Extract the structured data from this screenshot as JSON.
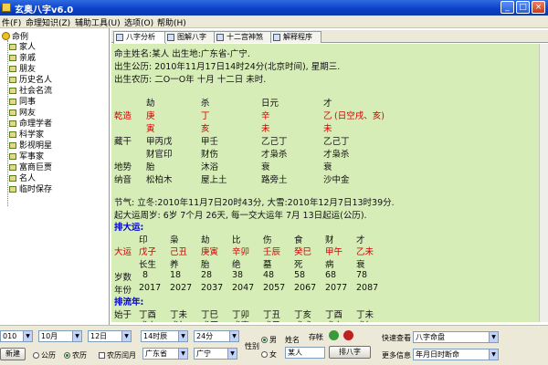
{
  "window": {
    "title": "玄奥八字v6.0",
    "minimize": "_",
    "maximize": "□",
    "close": "×"
  },
  "menu": [
    "件(F)",
    "命理知识(Z)",
    "辅助工具(U)",
    "选项(O)",
    "帮助(H)"
  ],
  "tree": {
    "root": "命例",
    "items": [
      "家人",
      "亲戚",
      "朋友",
      "历史名人",
      "社会名流",
      "同事",
      "网友",
      "命理学者",
      "科学家",
      "影视明星",
      "军事家",
      "富商巨贾",
      "名人",
      "临时保存"
    ]
  },
  "tabs": [
    "八字分析",
    "图解八字",
    "十二宫神煞",
    "解释程序"
  ],
  "chart": {
    "name_line": "命主姓名:某人  出生地:广东省-广宁.",
    "solar_line": "出生公历: 2010年11月17日14时24分(北京时间), 星期三.",
    "lunar_line": "出生农历: 二O一O年 十月 十二日 未时.",
    "gods_row": [
      "劫",
      "杀",
      "日元",
      "才"
    ],
    "qianzao_label": "乾造",
    "stems": [
      "庚",
      "丁",
      "辛",
      "乙"
    ],
    "kongwang": "(日空戌、亥)",
    "branches": [
      "寅",
      "亥",
      "未",
      "未"
    ],
    "canggan_label": "藏干",
    "canggan": [
      "甲丙戊",
      "甲壬",
      "乙己丁",
      "乙己丁"
    ],
    "canggan_gods": [
      "财官印",
      "财伤",
      "才枭杀",
      "才枭杀"
    ],
    "dishi_label": "地势",
    "dishi": [
      "胎",
      "沐浴",
      "衰",
      "衰"
    ],
    "nayin_label": "纳音",
    "nayin": [
      "松柏木",
      "屋上土",
      "路旁土",
      "沙中金"
    ],
    "jieqi_line": "节气: 立冬:2010年11月7日20时43分, 大雪:2010年12月7日13时39分.",
    "qiyun_line": "起大运周岁: 6岁 7个月 26天, 每一交大运年 7月 13日起运(公历).",
    "dayun_title": "排大运:",
    "dayun_gods": [
      "印",
      "枭",
      "劫",
      "比",
      "伤",
      "食",
      "财",
      "才"
    ],
    "dayun_label": "大运",
    "dayun_pillars": [
      "戊子",
      "己丑",
      "庚寅",
      "辛卯",
      "壬辰",
      "癸巳",
      "甲午",
      "乙未"
    ],
    "dayun_states": [
      "长生",
      "养",
      "胎",
      "绝",
      "墓",
      "死",
      "病",
      "衰"
    ],
    "age_label": "岁数",
    "ages": [
      "8",
      "18",
      "28",
      "38",
      "48",
      "58",
      "68",
      "78"
    ],
    "year_label": "年份",
    "years": [
      "2017",
      "2027",
      "2037",
      "2047",
      "2057",
      "2067",
      "2077",
      "2087"
    ],
    "liunian_title": "排流年:",
    "start_label": "始于",
    "liunian_stems": [
      "丁酉",
      "丁未",
      "丁巳",
      "丁卯",
      "丁丑",
      "丁亥",
      "丁酉",
      "丁未"
    ],
    "liunian_branches": [
      "戊申",
      "戊午",
      "戊辰",
      "戊寅",
      "戊子",
      "戊戌",
      "戊申",
      "戊午"
    ]
  },
  "bottom": {
    "year": "010",
    "month": "10月",
    "day": "12日",
    "hour": "14时辰",
    "minute": "24分",
    "new_button": "新建",
    "calendar_gongli": "公历",
    "calendar_nongli": "农历",
    "nongli_run": "农历闰月",
    "province": "广东省",
    "city": "广宁",
    "gender_label": "性别",
    "male": "男",
    "female": "女",
    "name_label": "姓名",
    "name_value": "某人",
    "save_label": "存帐",
    "paipan_button": "排八字",
    "quick_label": "快速查看",
    "quick_value": "八字命盘",
    "more_label": "更多信息",
    "more_value": "年月日时断命"
  },
  "colors": {
    "content_bg": "#d6edb8",
    "accent_red": "#d10000",
    "accent_blue": "#0000cc"
  }
}
